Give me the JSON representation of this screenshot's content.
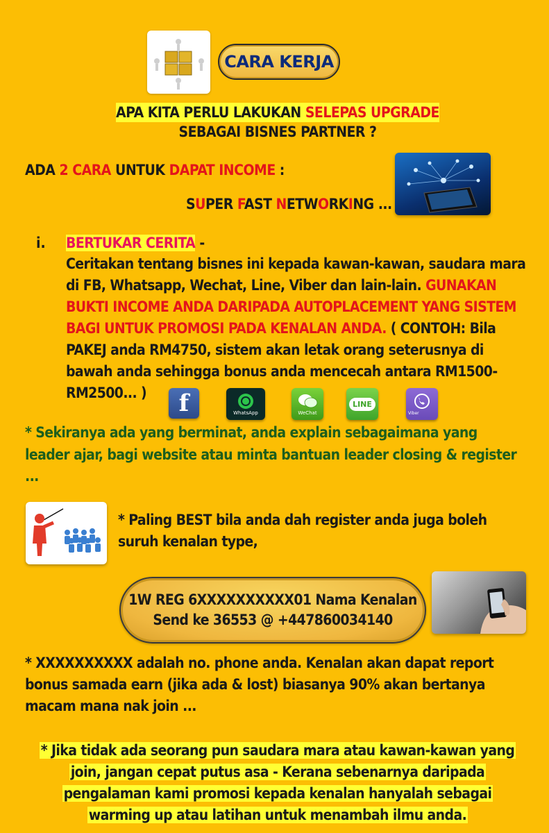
{
  "header": {
    "badge_label": "CARA KERJA"
  },
  "heading": {
    "line1_black": "APA KITA PERLU LAKUKAN ",
    "line1_red": "SELEPAS UPGRADE",
    "line2": "SEBAGAI BISNES PARTNER ?"
  },
  "income": {
    "part1": "ADA ",
    "part2": "2 CARA",
    "part3": " UNTUK ",
    "part4": "DAPAT INCOME",
    "part5": " :"
  },
  "super_fast_networking": {
    "letters": [
      {
        "t": "S",
        "c": "dark"
      },
      {
        "t": "U",
        "c": "red"
      },
      {
        "t": "PER ",
        "c": "dark"
      },
      {
        "t": "F",
        "c": "red"
      },
      {
        "t": "AST ",
        "c": "dark"
      },
      {
        "t": "N",
        "c": "red"
      },
      {
        "t": "ETW",
        "c": "dark"
      },
      {
        "t": "O",
        "c": "red"
      },
      {
        "t": "RK",
        "c": "dark"
      },
      {
        "t": "I",
        "c": "red"
      },
      {
        "t": "NG ...",
        "c": "dark"
      }
    ]
  },
  "item1": {
    "number": "i.",
    "title": "BERTUKAR CERITA",
    "title_suffix": " -",
    "body1": "Ceritakan tentang bisnes ini kepada kawan-kawan, saudara mara di FB, Whatsapp, Wechat, Line, Viber dan lain-lain. ",
    "body_red": "GUNAKAN BUKTI INCOME ANDA DARIPADA AUTOPLACEMENT YANG SISTEM BAGI UNTUK PROMOSI PADA KENALAN ANDA.",
    "body2": " ( CONTOH: Bila PAKEJ anda RM4750, sistem akan letak orang seterusnya di bawah anda sehingga bonus anda mencecah antara RM1500-RM2500... )"
  },
  "social_icons": {
    "facebook": "f",
    "whatsapp": "WhatsApp",
    "wechat": "WeChat",
    "line": "LINE",
    "viber": "Viber"
  },
  "green_para": "* Sekiranya ada yang berminat, anda explain sebagaimana yang leader ajar, bagi website atau minta bantuan leader closing & register ...",
  "best_para": "* Paling BEST bila anda dah register anda juga boleh suruh kenalan type,",
  "sms": {
    "line1": "1W REG 6XXXXXXXXXX01 Nama Kenalan",
    "line2": "Send ke 36553 @ +447860034140"
  },
  "xx_para": "* XXXXXXXXXX adalah no. phone anda. Kenalan akan dapat report bonus samada earn (jika ada & lost) biasanya 90% akan bertanya macam mana nak join ...",
  "final_para": {
    "line1": "* Jika tidak ada seorang pun saudara mara atau kawan-kawan yang",
    "line2": "join, jangan cepat putus asa - Kerana sebenarnya daripada",
    "line3": "pengalaman kami promosi kepada kenalan hanyalah sebagai",
    "line4": "warming up atau latihan untuk menambah ilmu anda."
  },
  "colors": {
    "background": "#FCBE04",
    "red": "#E3151B",
    "pink": "#E8145C",
    "green": "#1D5E1D",
    "highlight": "#FFFF33",
    "badge_text": "#0D2B7A"
  }
}
